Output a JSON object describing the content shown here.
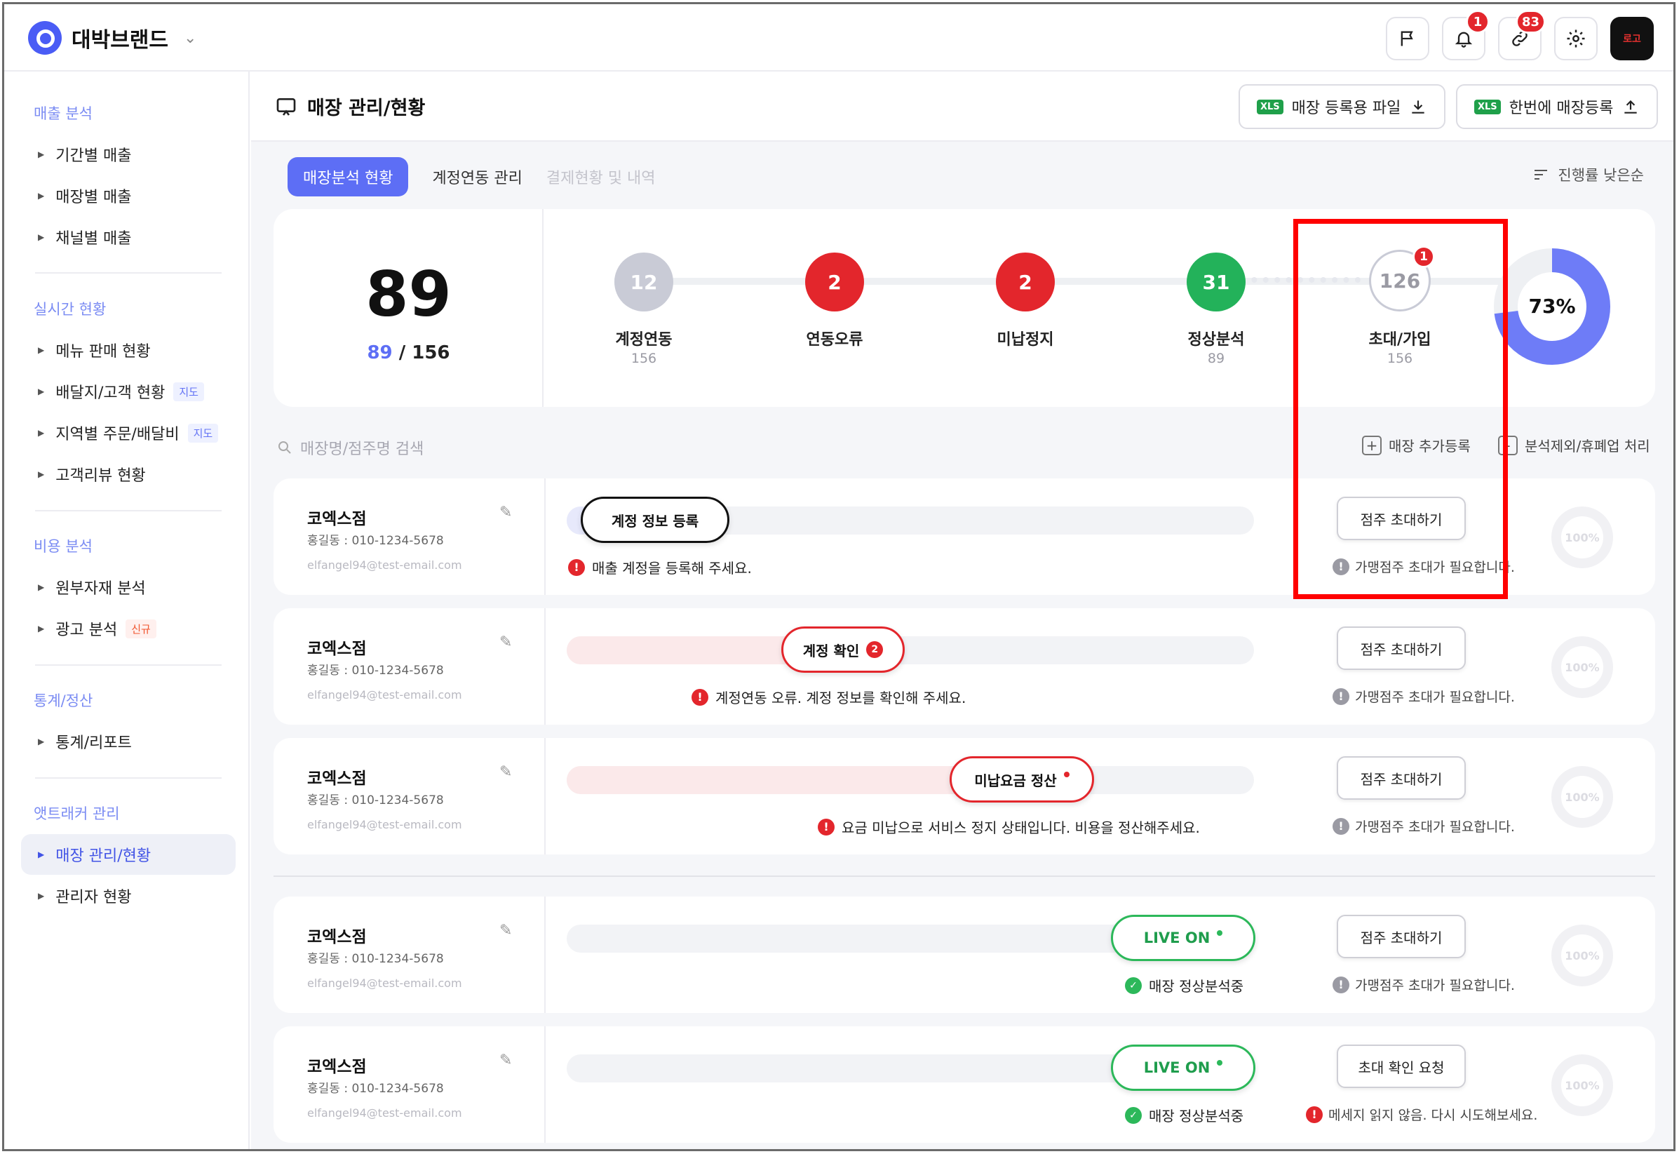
{
  "brand": {
    "name": "대박브랜드"
  },
  "topbar": {
    "notif_count": "1",
    "link_count": "83",
    "avatar_text": "로고"
  },
  "sidebar": {
    "sections": [
      {
        "title": "매출 분석",
        "items": [
          {
            "label": "기간별 매출"
          },
          {
            "label": "매장별 매출"
          },
          {
            "label": "채널별 매출"
          }
        ]
      },
      {
        "title": "실시간 현황",
        "items": [
          {
            "label": "메뉴 판매 현황"
          },
          {
            "label": "배달지/고객 현황",
            "tag": "지도"
          },
          {
            "label": "지역별 주문/배달비",
            "tag": "지도"
          },
          {
            "label": "고객리뷰 현황"
          }
        ]
      },
      {
        "title": "비용 분석",
        "items": [
          {
            "label": "원부자재 분석"
          },
          {
            "label": "광고 분석",
            "tag": "신규"
          }
        ]
      },
      {
        "title": "통계/정산",
        "items": [
          {
            "label": "통계/리포트"
          }
        ]
      },
      {
        "title": "앳트래커 관리",
        "items": [
          {
            "label": "매장 관리/현황"
          },
          {
            "label": "관리자 현황"
          }
        ]
      }
    ]
  },
  "page": {
    "title": "매장 관리/현황",
    "btn_file": "매장 등록용 파일",
    "btn_bulk": "한번에 매장등록",
    "xls": "XLS",
    "tabs": [
      "매장분석 현황",
      "계정연동 관리",
      "결제현황 및 내역"
    ],
    "sort": "진행률 낮은순"
  },
  "summary": {
    "total": "89",
    "current": "89",
    "of": "/ 156",
    "steps": [
      {
        "count": "12",
        "label": "계정연동",
        "sub": "156"
      },
      {
        "count": "2",
        "label": "연동오류",
        "sub": ""
      },
      {
        "count": "2",
        "label": "미납정지",
        "sub": ""
      },
      {
        "count": "31",
        "label": "정상분석",
        "sub": "89"
      },
      {
        "count": "126",
        "label": "초대/가입",
        "sub": "156",
        "badge": "1"
      }
    ],
    "donut_percent": "73%",
    "donut_value": 73
  },
  "search": {
    "placeholder": "매장명/점주명 검색",
    "add": "매장 추가등록",
    "exclude": "분석제외/휴폐업 처리"
  },
  "rows": [
    {
      "name": "코엑스점",
      "owner": "홍길동 : 010-1234-5678",
      "email": "elfangel94@test-email.com",
      "pill": "계정 정보 등록",
      "msg": "매출 계정을 등록해 주세요.",
      "invite": "점주 초대하기",
      "invite_msg": "가맹점주 초대가 필요합니다.",
      "ring": "100%"
    },
    {
      "name": "코엑스점",
      "owner": "홍길동 : 010-1234-5678",
      "email": "elfangel94@test-email.com",
      "pill": "계정 확인",
      "pill_badge": "2",
      "msg": "계정연동 오류. 계정 정보를 확인해 주세요.",
      "invite": "점주 초대하기",
      "invite_msg": "가맹점주 초대가 필요합니다.",
      "ring": "100%"
    },
    {
      "name": "코엑스점",
      "owner": "홍길동 : 010-1234-5678",
      "email": "elfangel94@test-email.com",
      "pill": "미납요금 정산",
      "msg": "요금 미납으로 서비스 정지 상태입니다. 비용을 정산해주세요.",
      "invite": "점주 초대하기",
      "invite_msg": "가맹점주 초대가 필요합니다.",
      "ring": "100%"
    },
    {
      "name": "코엑스점",
      "owner": "홍길동 : 010-1234-5678",
      "email": "elfangel94@test-email.com",
      "pill": "LIVE ON",
      "msg": "매장 정상분석중",
      "invite": "점주 초대하기",
      "invite_msg": "가맹점주 초대가 필요합니다.",
      "ring": "100%"
    },
    {
      "name": "코엑스점",
      "owner": "홍길동 : 010-1234-5678",
      "email": "elfangel94@test-email.com",
      "pill": "LIVE ON",
      "msg": "매장 정상분석중",
      "invite": "초대 확인 요청",
      "invite_msg": "메세지 읽지 않음. 다시 시도해보세요.",
      "ring": "100%"
    }
  ],
  "colors": {
    "accent": "#5d6ef5",
    "error": "#e3262c",
    "success": "#2cb85a",
    "highlight_box": "#ff0000"
  }
}
